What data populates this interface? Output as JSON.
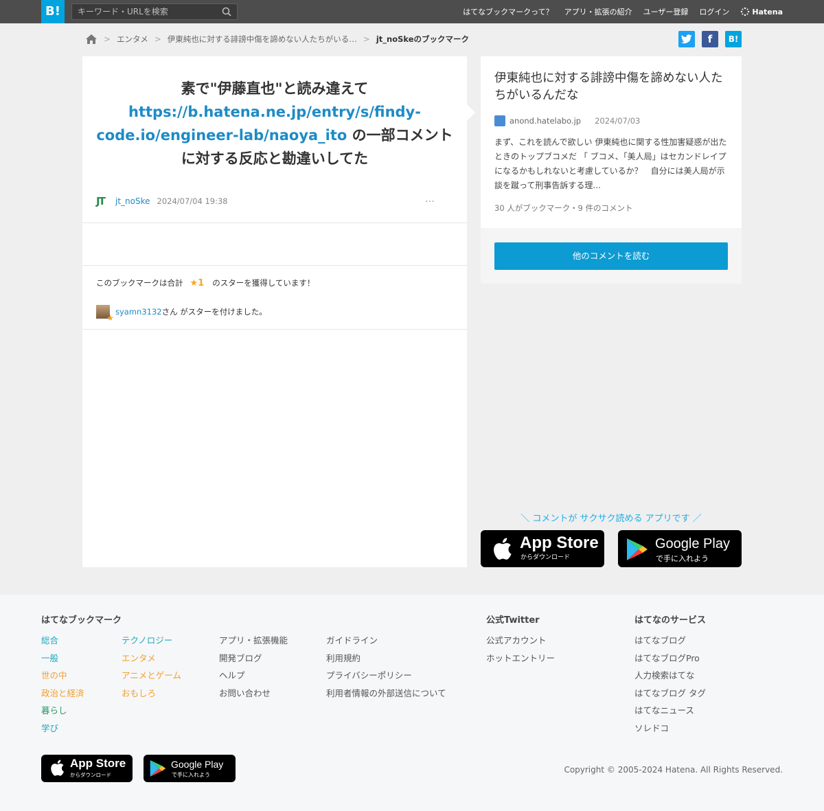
{
  "header": {
    "logo": "B!",
    "search_placeholder": "キーワード・URLを検索",
    "nav": [
      "はてなブックマークって？",
      "アプリ・拡張の紹介",
      "ユーザー登録",
      "ログイン"
    ],
    "brand": "Hatena"
  },
  "breadcrumb": {
    "items": [
      "エンタメ",
      "伊東純也に対する誹謗中傷を諦めない人たちがいる…",
      "jt_noSkeのブックマーク"
    ]
  },
  "share": {
    "facebook": "f",
    "hatena": "B!"
  },
  "comment": {
    "text_before": "素で\"伊藤直也\"と読み違えて",
    "link": "https://b.hatena.ne.jp/entry/s/findy-code.io/engineer-lab/naoya_ito",
    "text_after": " の一部コメントに対する反応と勘違いしてた",
    "user_icon": "JT",
    "user": "jt_noSke",
    "date": "2024/07/04 19:38",
    "more": "…"
  },
  "stars": {
    "summary_prefix": "このブックマークは合計",
    "count": "★1",
    "summary_suffix": "のスターを獲得しています！",
    "giver": "syamn3132",
    "giver_suffix": "さん がスターを付けました。"
  },
  "entry": {
    "title": "伊東純也に対する誹謗中傷を諦めない人たちがいるんだな",
    "site": "anond.hatelabo.jp",
    "date": "2024/07/03",
    "summary": "まず、これを読んで欲しい 伊東純也に関する性加害疑惑が出たときのトップブコメだ 「 ブコメ、「美人局」はセカンドレイプになるかもしれないと考慮しているか？　自分には美人局が示談を蹴って刑事告訴する理...",
    "count": "30 人がブックマーク・9 件のコメント",
    "read_more": "他のコメントを読む"
  },
  "app": {
    "tagline": "＼ コメントが サクサク読める アプリです ／",
    "appstore_big": "App Store",
    "appstore_small": "からダウンロード",
    "googleplay_big": "Google Play",
    "googleplay_small": "で手に入れよう"
  },
  "footer": {
    "bookmark_heading": "はてなブックマーク",
    "categories_a": [
      "総合",
      "一般",
      "世の中",
      "政治と経済",
      "暮らし",
      "学び"
    ],
    "categories_b": [
      "テクノロジー",
      "エンタメ",
      "アニメとゲーム",
      "おもしろ"
    ],
    "links_a": [
      "アプリ・拡張機能",
      "開発ブログ",
      "ヘルプ",
      "お問い合わせ"
    ],
    "links_b": [
      "ガイドライン",
      "利用規約",
      "プライバシーポリシー",
      "利用者情報の外部送信について"
    ],
    "twitter_heading": "公式Twitter",
    "twitter_links": [
      "公式アカウント",
      "ホットエントリー"
    ],
    "services_heading": "はてなのサービス",
    "services": [
      "はてなブログ",
      "はてなブログPro",
      "人力検索はてな",
      "はてなブログ タグ",
      "はてなニュース",
      "ソレドコ"
    ],
    "copyright": "Copyright © 2005-2024 Hatena. All Rights Reserved."
  }
}
